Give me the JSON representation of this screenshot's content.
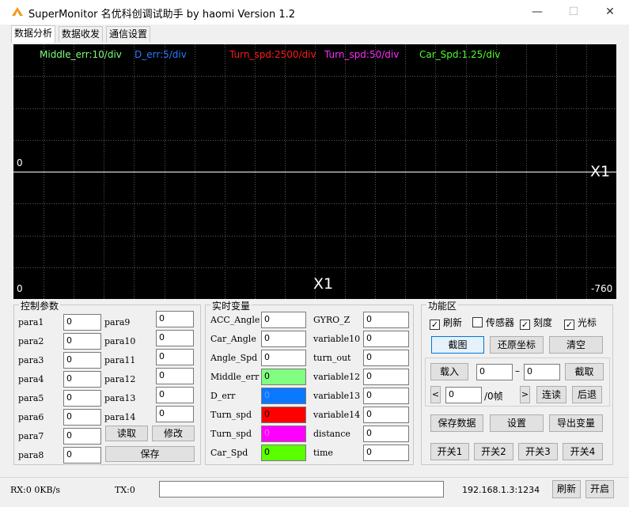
{
  "window": {
    "title": "SuperMonitor 名优科创调试助手 by haomi    Version 1.2",
    "minimize": "—",
    "maximize": "☐",
    "close": "✕"
  },
  "tabs": [
    {
      "label": "数据分析",
      "active": true
    },
    {
      "label": "数据收发",
      "active": false
    },
    {
      "label": "通信设置",
      "active": false
    }
  ],
  "scope": {
    "channels": [
      {
        "text": "Middle_err:10/div",
        "color": "#7dff7d"
      },
      {
        "text": "D_err:5/div",
        "color": "#2b7bff"
      },
      {
        "text": "Turn_spd:2500/div",
        "color": "#ff1a1a"
      },
      {
        "text": "Turn_spd:50/div",
        "color": "#ff2bff"
      },
      {
        "text": "Car_Spd:1.25/div",
        "color": "#4dff2b"
      }
    ],
    "zero_label_mid": "0",
    "zero_label_bottom": "0",
    "x_marker_right": "X1",
    "x_marker_bottom": "X1",
    "end_value": "-760"
  },
  "control": {
    "title": "控制参数",
    "params_left": [
      {
        "label": "para1",
        "value": "0"
      },
      {
        "label": "para2",
        "value": "0"
      },
      {
        "label": "para3",
        "value": "0"
      },
      {
        "label": "para4",
        "value": "0"
      },
      {
        "label": "para5",
        "value": "0"
      },
      {
        "label": "para6",
        "value": "0"
      },
      {
        "label": "para7",
        "value": "0"
      },
      {
        "label": "para8",
        "value": "0"
      }
    ],
    "params_right": [
      {
        "label": "para9",
        "value": "0"
      },
      {
        "label": "para10",
        "value": "0"
      },
      {
        "label": "para11",
        "value": "0"
      },
      {
        "label": "para12",
        "value": "0"
      },
      {
        "label": "para13",
        "value": "0"
      },
      {
        "label": "para14",
        "value": "0"
      }
    ],
    "read_btn": "读取",
    "modify_btn": "修改",
    "save_btn": "保存"
  },
  "realtime": {
    "title": "实时变量",
    "left": [
      {
        "label": "ACC_Angle",
        "value": "0",
        "color": "#ffffff"
      },
      {
        "label": "Car_Angle",
        "value": "0",
        "color": "#ffffff"
      },
      {
        "label": "Angle_Spd",
        "value": "0",
        "color": "#ffffff"
      },
      {
        "label": "Middle_err",
        "value": "0",
        "color": "#80ff80"
      },
      {
        "label": "D_err",
        "value": "0",
        "color": "#0a78ff"
      },
      {
        "label": "Turn_spd",
        "value": "0",
        "color": "#ff0000"
      },
      {
        "label": "Turn_spd",
        "value": "0",
        "color": "#ff00ff"
      },
      {
        "label": "Car_Spd",
        "value": "0",
        "color": "#5aff00"
      }
    ],
    "right": [
      {
        "label": "GYRO_Z",
        "value": "0"
      },
      {
        "label": "variable10",
        "value": "0"
      },
      {
        "label": "turn_out",
        "value": "0"
      },
      {
        "label": "variable12",
        "value": "0"
      },
      {
        "label": "variable13",
        "value": "0"
      },
      {
        "label": "variable14",
        "value": "0"
      },
      {
        "label": "distance",
        "value": "0"
      },
      {
        "label": "time",
        "value": "0"
      }
    ]
  },
  "func": {
    "title": "功能区",
    "checks": [
      {
        "label": "刷新",
        "checked": true
      },
      {
        "label": "传感器",
        "checked": false
      },
      {
        "label": "刻度",
        "checked": true
      },
      {
        "label": "光标",
        "checked": true
      }
    ],
    "screenshot_btn": "截图",
    "restore_btn": "还原坐标",
    "clear_btn": "清空",
    "load_btn": "载入",
    "range_from": "0",
    "range_dash": "–",
    "range_to": "0",
    "cut_btn": "截取",
    "prev_arrow": "<",
    "frame_value": "0",
    "frame_unit": "/0帧",
    "next_arrow": ">",
    "continuous_btn": "连读",
    "back_btn": "后退",
    "save_data_btn": "保存数据",
    "settings_btn": "设置",
    "export_btn": "导出变量",
    "switch_btns": [
      "开关1",
      "开关2",
      "开关3",
      "开关4"
    ]
  },
  "status": {
    "rx": "RX:0 0KB/s",
    "tx": "TX:0",
    "input_value": "",
    "address": "192.168.1.3:1234",
    "refresh_btn": "刷新",
    "start_btn": "开启"
  }
}
